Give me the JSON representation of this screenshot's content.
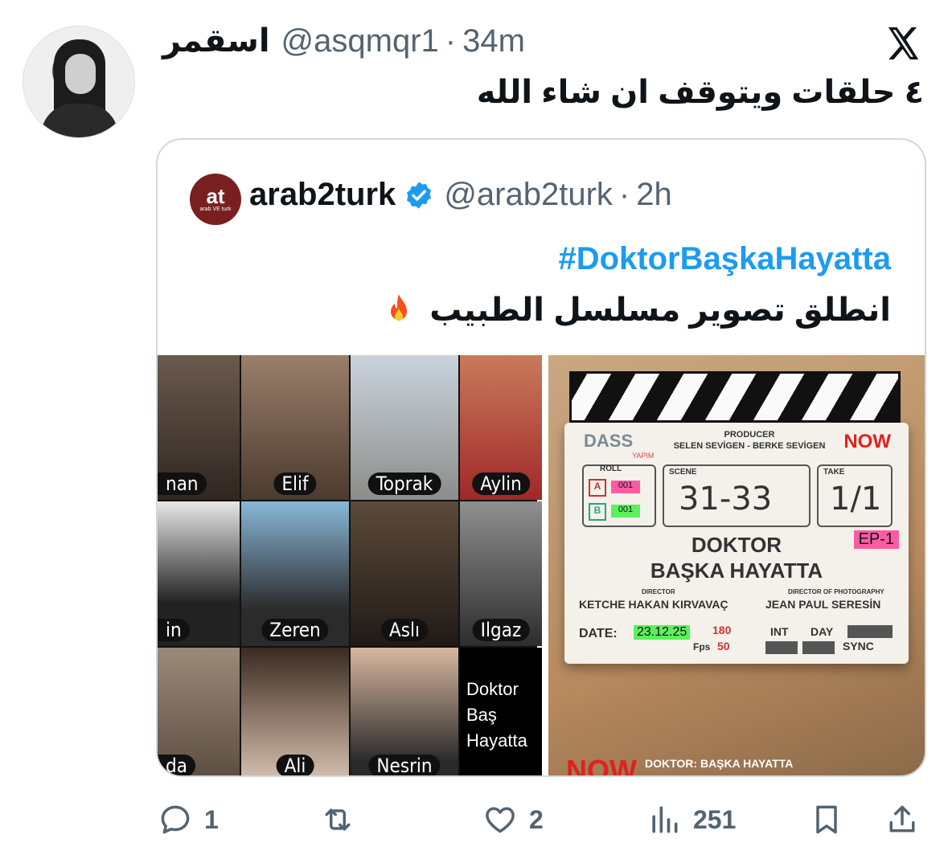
{
  "tweet": {
    "display_name": "اسقمر",
    "handle": "@asqmqr1",
    "separator": "·",
    "time": "34m",
    "text": "٤ حلقات ويتوقف ان شاء الله"
  },
  "quoted": {
    "avatar_text": "at",
    "avatar_sub": "arab VE turk",
    "name": "arab2turk",
    "handle": "@arab2turk",
    "separator": "·",
    "time": "2h",
    "hashtag": "#DoktorBaşkaHayatta",
    "text": "انطلق تصوير مسلسل الطبيب",
    "cast_labels": [
      "nan",
      "Elif",
      "Toprak",
      "Aylin",
      "in",
      "Zeren",
      "Aslı",
      "Ilgaz",
      "da",
      "Ali",
      "Nesrin"
    ],
    "cast_last": "Doktor Baş Hayatta",
    "slate": {
      "company": "DASS",
      "company_sub": "YAPIM",
      "producer_label": "PRODUCER",
      "producer_names": "SELEN SEVİGEN - BERKE SEVİGEN",
      "network": "NOW",
      "roll_label": "ROLL",
      "roll_a": "A",
      "roll_a_value": "001",
      "roll_b": "B",
      "roll_b_value": "001",
      "scene_label": "SCENE",
      "scene_value": "31-33",
      "take_label": "TAKE",
      "take_value": "1/1",
      "title_line1": "DOKTOR",
      "title_line2": "BAŞKA HAYATTA",
      "episode": "EP-1",
      "director_label": "DIRECTOR",
      "director_name": "KETCHE HAKAN KIRVAVAÇ",
      "dop_label": "DIRECTOR OF PHOTOGRAPHY",
      "dop_name": "JEAN PAUL SERESİN",
      "date_label": "DATE:",
      "date_value": "23.12.25",
      "fps_label": "Fps",
      "fps_value": "50",
      "a_value": "180",
      "int_label": "INT",
      "day_label": "DAY",
      "sync_label": "SYNC"
    },
    "bottom_network": "NOW",
    "bottom_title": "DOKTOR: BAŞKA HAYATTA"
  },
  "actions": {
    "replies": "1",
    "reposts": "",
    "likes": "2",
    "views": "251"
  },
  "colors": {
    "accent": "#1d9bf0",
    "secondary_text": "#536471",
    "border": "#cfd9de"
  }
}
